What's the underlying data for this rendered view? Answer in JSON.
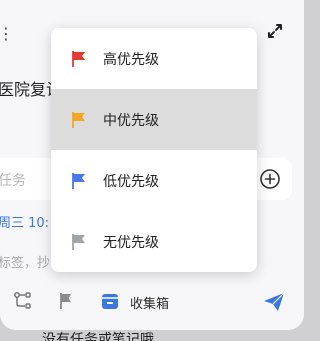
{
  "colors": {
    "accent": "#3a78e0",
    "priority_high": "#e53935",
    "priority_medium": "#f5a623",
    "priority_low": "#4a78e6",
    "priority_none": "#9ea5ab",
    "selected_bg": "#dcdcdc"
  },
  "task": {
    "title_partial": "医院复诊",
    "subtask_placeholder": "任务",
    "date_partial": "周三 10:",
    "tag_hint_partial": "标签，抄"
  },
  "toolbar": {
    "list_label": "收集箱"
  },
  "empty_hint": "没有任务或笔记哦",
  "priority_menu": {
    "selected_index": 1,
    "options": [
      {
        "label": "高优先级",
        "icon": "red-flag-icon"
      },
      {
        "label": "中优先级",
        "icon": "orange-flag-icon"
      },
      {
        "label": "低优先级",
        "icon": "blue-flag-icon"
      },
      {
        "label": "无优先级",
        "icon": "gray-flag-icon"
      }
    ]
  }
}
